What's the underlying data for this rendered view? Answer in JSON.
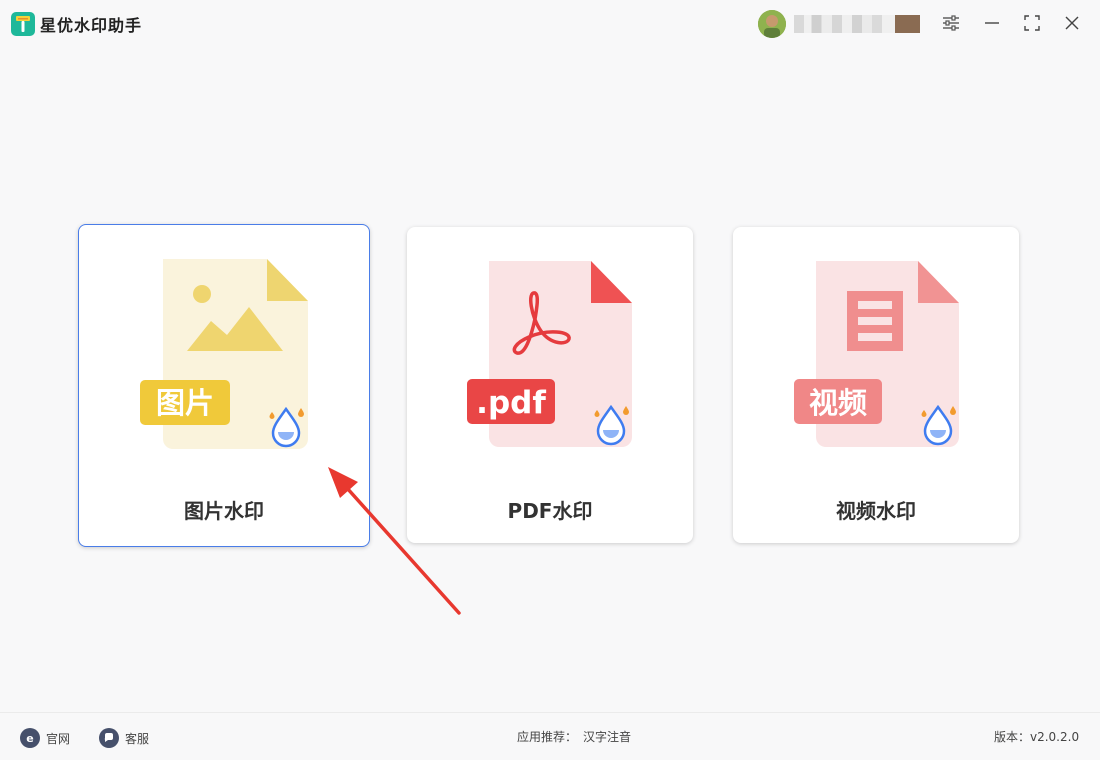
{
  "app": {
    "title": "星优水印助手"
  },
  "cards": [
    {
      "label": "图片水印",
      "badge": "图片",
      "active": true
    },
    {
      "label": "PDF水印",
      "badge": ".pdf",
      "active": false
    },
    {
      "label": "视频水印",
      "badge": "视频",
      "active": false
    }
  ],
  "footer": {
    "website": "官网",
    "support": "客服",
    "recommend_label": "应用推荐：",
    "recommend_app": "汉字注音",
    "version": "版本：v2.0.2.0"
  },
  "icons": {
    "settings": "sliders-icon",
    "minimize": "minimize-icon",
    "maximize": "maximize-icon",
    "close": "close-icon"
  },
  "colors": {
    "accent": "#4a7de8",
    "image_card": "#f0cf55",
    "pdf_card": "#e94b4b",
    "video_card": "#f08b8b",
    "arrow": "#e8382f"
  }
}
